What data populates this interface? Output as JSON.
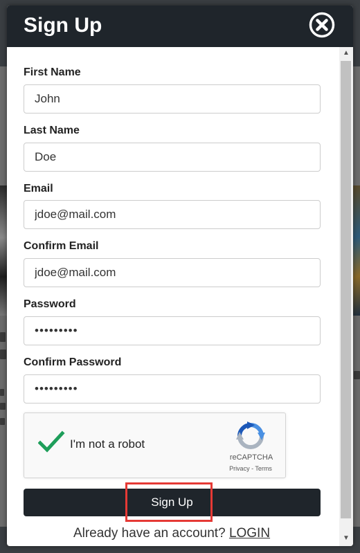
{
  "modal": {
    "title": "Sign Up",
    "close_icon": "close-circle-x-icon"
  },
  "form": {
    "first_name": {
      "label": "First Name",
      "value": "John"
    },
    "last_name": {
      "label": "Last Name",
      "value": "Doe"
    },
    "email": {
      "label": "Email",
      "value": "jdoe@mail.com"
    },
    "confirm_email": {
      "label": "Confirm Email",
      "value": "jdoe@mail.com"
    },
    "password": {
      "label": "Password",
      "value": "•••••••••"
    },
    "confirm_password": {
      "label": "Confirm Password",
      "value": "•••••••••"
    }
  },
  "recaptcha": {
    "label": "I'm not a robot",
    "brand": "reCAPTCHA",
    "privacy": "Privacy",
    "separator": " - ",
    "terms": "Terms",
    "checked": true
  },
  "actions": {
    "submit_label": "Sign Up",
    "login_prompt": "Already have an account? ",
    "login_link": "LOGIN"
  },
  "colors": {
    "header_bg": "#1f252b",
    "button_bg": "#1f252b",
    "highlight": "#e53935",
    "check": "#1e9e5a"
  }
}
